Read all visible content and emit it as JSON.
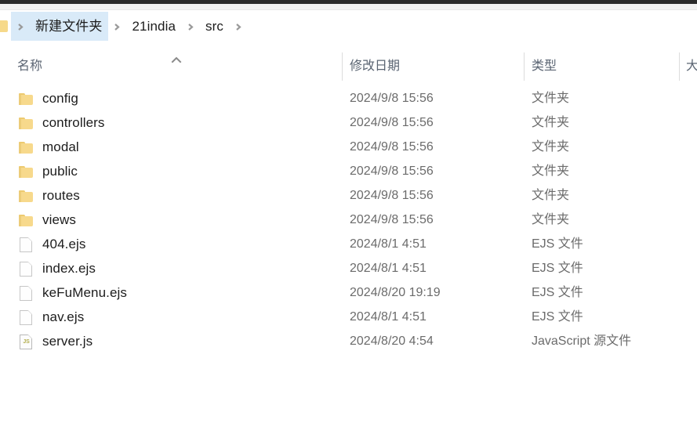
{
  "window": {
    "chrome_strip_color": "#2b2b2b"
  },
  "breadcrumb": {
    "lead_icon": "folder-icon",
    "separator_glyph": "chevron-right-icon",
    "items": [
      {
        "label": "新建文件夹",
        "highlighted": true
      },
      {
        "label": "21india",
        "highlighted": false
      },
      {
        "label": "src",
        "highlighted": false
      }
    ],
    "highlight_color": "#d9eaf8"
  },
  "columns": {
    "name": {
      "label": "名称",
      "sort_indicator": "chevron-up-icon",
      "sort_direction": "ascending"
    },
    "date_modified": {
      "label": "修改日期"
    },
    "type": {
      "label": "类型"
    },
    "size": {
      "label": "大"
    }
  },
  "files": {
    "rows": [
      {
        "name": "config",
        "icon": "folder-icon",
        "date": "2024/9/8 15:56",
        "type": "文件夹"
      },
      {
        "name": "controllers",
        "icon": "folder-icon",
        "date": "2024/9/8 15:56",
        "type": "文件夹"
      },
      {
        "name": "modal",
        "icon": "folder-icon",
        "date": "2024/9/8 15:56",
        "type": "文件夹"
      },
      {
        "name": "public",
        "icon": "folder-icon",
        "date": "2024/9/8 15:56",
        "type": "文件夹"
      },
      {
        "name": "routes",
        "icon": "folder-icon",
        "date": "2024/9/8 15:56",
        "type": "文件夹"
      },
      {
        "name": "views",
        "icon": "folder-icon",
        "date": "2024/9/8 15:56",
        "type": "文件夹"
      },
      {
        "name": "404.ejs",
        "icon": "document-icon",
        "date": "2024/8/1 4:51",
        "type": "EJS 文件"
      },
      {
        "name": "index.ejs",
        "icon": "document-icon",
        "date": "2024/8/1 4:51",
        "type": "EJS 文件"
      },
      {
        "name": "keFuMenu.ejs",
        "icon": "document-icon",
        "date": "2024/8/20 19:19",
        "type": "EJS 文件"
      },
      {
        "name": "nav.ejs",
        "icon": "document-icon",
        "date": "2024/8/1 4:51",
        "type": "EJS 文件"
      },
      {
        "name": "server.js",
        "icon": "javascript-file-icon",
        "js_badge": "JS",
        "date": "2024/8/20 4:54",
        "type": "JavaScript 源文件"
      }
    ]
  }
}
